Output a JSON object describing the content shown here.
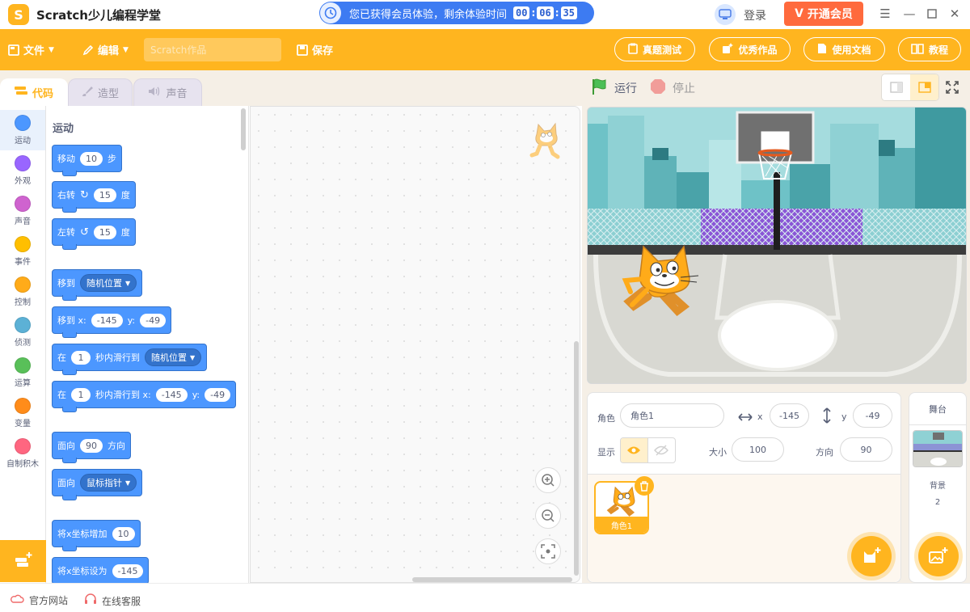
{
  "app": {
    "logo_letter": "S",
    "title": "Scratch少儿编程学堂",
    "trial_text": "您已获得会员体验，剩余体验时间",
    "timer": [
      "00",
      "06",
      "35"
    ],
    "login": "登录",
    "vip_button": "开通会员",
    "vip_prefix": "V"
  },
  "menu": {
    "file": "文件",
    "edit": "编辑",
    "project_placeholder": "Scratch作品",
    "save": "保存",
    "buttons": [
      "真题测试",
      "优秀作品",
      "使用文档",
      "教程"
    ]
  },
  "tabs": [
    "代码",
    "造型",
    "声音"
  ],
  "categories": [
    {
      "label": "运动",
      "color": "#4c97ff"
    },
    {
      "label": "外观",
      "color": "#9966ff"
    },
    {
      "label": "声音",
      "color": "#cf63cf"
    },
    {
      "label": "事件",
      "color": "#ffbf00"
    },
    {
      "label": "控制",
      "color": "#ffab19"
    },
    {
      "label": "侦测",
      "color": "#5cb1d6"
    },
    {
      "label": "运算",
      "color": "#59c059"
    },
    {
      "label": "变量",
      "color": "#ff8c1a"
    },
    {
      "label": "自制积木",
      "color": "#ff6680"
    }
  ],
  "palette": {
    "title": "运动",
    "move": {
      "a": "移动",
      "v": "10",
      "b": "步"
    },
    "turn_right": {
      "a": "右转",
      "v": "15",
      "b": "度"
    },
    "turn_left": {
      "a": "左转",
      "v": "15",
      "b": "度"
    },
    "goto": {
      "a": "移到",
      "d": "随机位置"
    },
    "goto_xy": {
      "a": "移到 x:",
      "x": "-145",
      "b": "y:",
      "y": "-49"
    },
    "glide": {
      "a": "在",
      "v": "1",
      "b": "秒内滑行到",
      "d": "随机位置"
    },
    "glide_xy": {
      "a": "在",
      "v": "1",
      "b": "秒内滑行到 x:",
      "x": "-145",
      "c": "y:",
      "y": "-49"
    },
    "point_dir": {
      "a": "面向",
      "v": "90",
      "b": "方向"
    },
    "point_towards": {
      "a": "面向",
      "d": "鼠标指针"
    },
    "change_x": {
      "a": "将x坐标增加",
      "v": "10"
    },
    "set_x": {
      "a": "将x坐标设为",
      "v": "-145"
    }
  },
  "run": {
    "go": "运行",
    "stop": "停止"
  },
  "sprite_info": {
    "sprite_label": "角色",
    "sprite_name": "角色1",
    "x_label": "x",
    "x": "-145",
    "y_label": "y",
    "y": "-49",
    "show_label": "显示",
    "size_label": "大小",
    "size": "100",
    "dir_label": "方向",
    "direction": "90"
  },
  "sprites": [
    {
      "name": "角色1"
    }
  ],
  "stage_panel": {
    "title": "舞台",
    "bg_label": "背景",
    "bg_count": "2"
  },
  "footer": {
    "site": "官方网站",
    "service": "在线客服"
  },
  "colors": {
    "accent": "#ffb51f",
    "motion": "#4c97ff",
    "vip": "#ff6a3d",
    "banner": "#3d7bf2"
  }
}
